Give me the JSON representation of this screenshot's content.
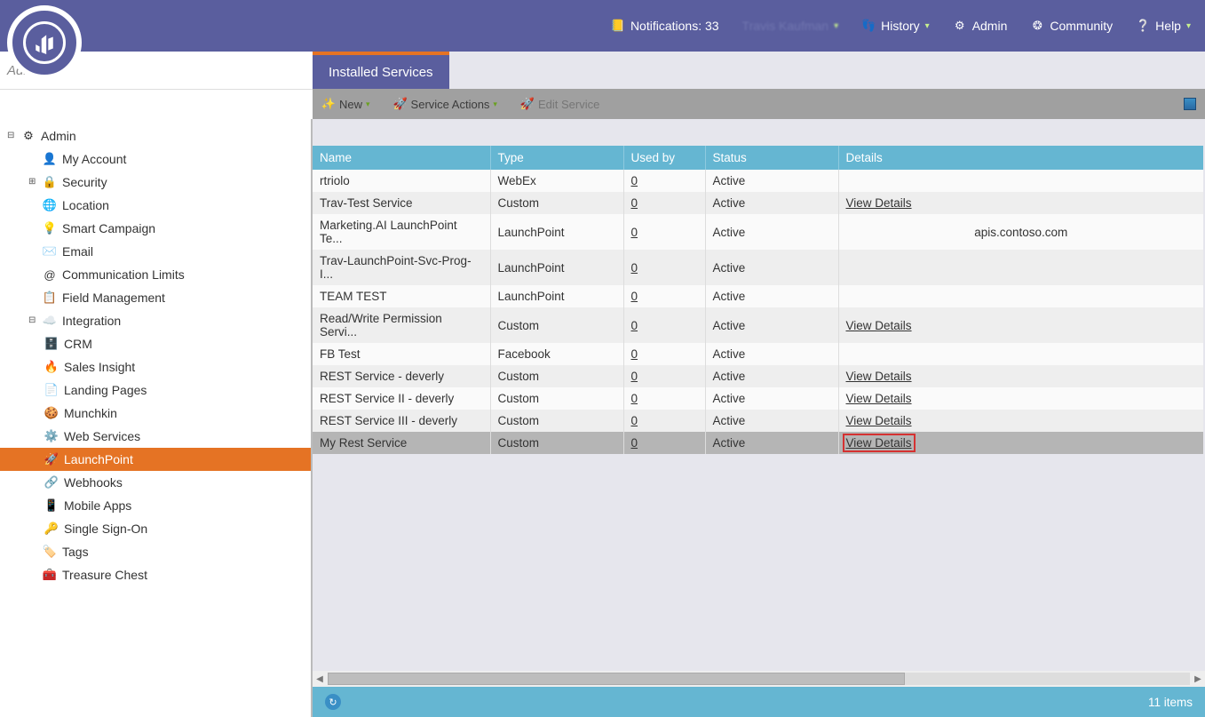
{
  "topbar": {
    "notifications_label": "Notifications: 33",
    "user_name": "Travis Kaufman",
    "history": "History",
    "admin": "Admin",
    "community": "Community",
    "help": "Help"
  },
  "search": {
    "placeholder": "Admin..."
  },
  "tab": {
    "title": "Installed Services"
  },
  "toolbar": {
    "new": "New",
    "service_actions": "Service Actions",
    "edit_service": "Edit Service"
  },
  "sidebar": {
    "root": "Admin",
    "my_account": "My Account",
    "security": "Security",
    "location": "Location",
    "smart_campaign": "Smart Campaign",
    "email": "Email",
    "comm_limits": "Communication Limits",
    "field_management": "Field Management",
    "integration": "Integration",
    "crm": "CRM",
    "sales_insight": "Sales Insight",
    "landing_pages": "Landing Pages",
    "munchkin": "Munchkin",
    "web_services": "Web Services",
    "launchpoint": "LaunchPoint",
    "webhooks": "Webhooks",
    "mobile_apps": "Mobile Apps",
    "sso": "Single Sign-On",
    "tags": "Tags",
    "treasure_chest": "Treasure Chest"
  },
  "grid": {
    "headers": {
      "name": "Name",
      "type": "Type",
      "used": "Used by",
      "status": "Status",
      "details": "Details"
    },
    "view_details": "View Details",
    "rows": [
      {
        "name": "rtriolo",
        "type": "WebEx",
        "used": "0",
        "status": "Active",
        "details": ""
      },
      {
        "name": "Trav-Test Service",
        "type": "Custom",
        "used": "0",
        "status": "Active",
        "details": "View Details"
      },
      {
        "name": "Marketing.AI LaunchPoint Te...",
        "type": "LaunchPoint",
        "used": "0",
        "status": "Active",
        "details": "apis.contoso.com"
      },
      {
        "name": "Trav-LaunchPoint-Svc-Prog-I...",
        "type": "LaunchPoint",
        "used": "0",
        "status": "Active",
        "details": ""
      },
      {
        "name": "TEAM TEST",
        "type": "LaunchPoint",
        "used": "0",
        "status": "Active",
        "details": ""
      },
      {
        "name": "Read/Write Permission Servi...",
        "type": "Custom",
        "used": "0",
        "status": "Active",
        "details": "View Details"
      },
      {
        "name": "FB Test",
        "type": "Facebook",
        "used": "0",
        "status": "Active",
        "details": ""
      },
      {
        "name": "REST Service - deverly",
        "type": "Custom",
        "used": "0",
        "status": "Active",
        "details": "View Details"
      },
      {
        "name": "REST Service II - deverly",
        "type": "Custom",
        "used": "0",
        "status": "Active",
        "details": "View Details"
      },
      {
        "name": "REST Service III - deverly",
        "type": "Custom",
        "used": "0",
        "status": "Active",
        "details": "View Details"
      },
      {
        "name": "My Rest Service",
        "type": "Custom",
        "used": "0",
        "status": "Active",
        "details": "View Details",
        "selected": true
      }
    ],
    "footer_count": "11 items"
  }
}
